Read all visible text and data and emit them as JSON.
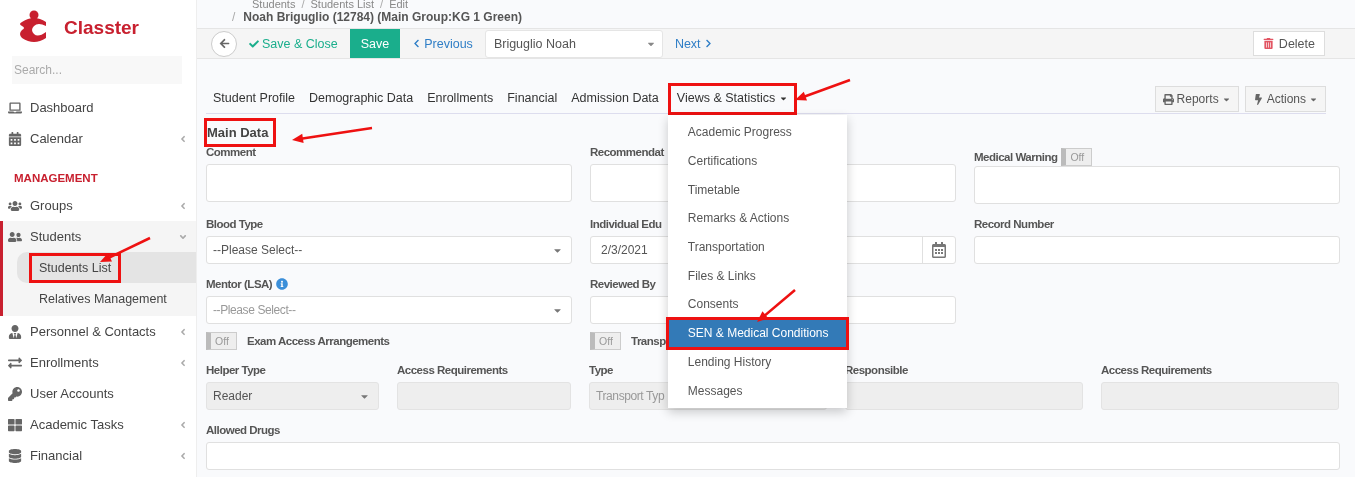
{
  "sidebar": {
    "logo_text": "Classter",
    "search": {
      "placeholder": "Search..."
    },
    "items": [
      {
        "kind": "link",
        "label": "Dashboard"
      },
      {
        "kind": "link",
        "label": "Calendar",
        "expanded": false
      },
      {
        "kind": "section",
        "label": "MANAGEMENT"
      },
      {
        "kind": "link",
        "label": "Groups",
        "expanded": false
      },
      {
        "kind": "link",
        "label": "Students",
        "expanded": true,
        "children": [
          {
            "label": "Students List",
            "selected": true,
            "highlighted": true
          },
          {
            "label": "Relatives Management",
            "selected": false,
            "highlighted": false
          }
        ]
      },
      {
        "kind": "link",
        "label": "Personnel & Contacts",
        "expanded": false
      },
      {
        "kind": "link",
        "label": "Enrollments",
        "expanded": false
      },
      {
        "kind": "link",
        "label": "User Accounts"
      },
      {
        "kind": "link",
        "label": "Academic Tasks",
        "expanded": false
      },
      {
        "kind": "link",
        "label": "Financial",
        "expanded": false
      }
    ]
  },
  "breadcrumb": [
    "Students",
    "Students List",
    "Edit"
  ],
  "breadcrumb_separator": "/",
  "page_title": "Noah Briguglio (12784) (Main Group:KG 1 Green)",
  "toolbar": {
    "save_close": "Save & Close",
    "save": "Save",
    "previous": "Previous",
    "record": "Briguglio Noah",
    "next": "Next",
    "delete": "Delete"
  },
  "tabs": [
    {
      "label": "Student Profile",
      "selected": false,
      "highlighted": false
    },
    {
      "label": "Demographic Data",
      "selected": false,
      "highlighted": false
    },
    {
      "label": "Enrollments",
      "selected": false,
      "highlighted": false
    },
    {
      "label": "Financial",
      "selected": false,
      "highlighted": false
    },
    {
      "label": "Admission Data",
      "selected": false,
      "highlighted": false
    },
    {
      "label": "Views & Statistics",
      "selected": false,
      "highlighted": true,
      "open": true,
      "menu": [
        {
          "label": "Academic Progress",
          "selected": false,
          "highlighted": false
        },
        {
          "label": "Certifications",
          "selected": false,
          "highlighted": false
        },
        {
          "label": "Timetable",
          "selected": false,
          "highlighted": false
        },
        {
          "label": "Remarks & Actions",
          "selected": false,
          "highlighted": false
        },
        {
          "label": "Transportation",
          "selected": false,
          "highlighted": false
        },
        {
          "label": "Files & Links",
          "selected": false,
          "highlighted": false
        },
        {
          "label": "Consents",
          "selected": false,
          "highlighted": false
        },
        {
          "label": "SEN & Medical Conditions",
          "selected": true,
          "highlighted": true
        },
        {
          "label": "Lending History",
          "selected": false,
          "highlighted": false
        },
        {
          "label": "Messages",
          "selected": false,
          "highlighted": false
        }
      ]
    }
  ],
  "tab_tools": [
    "Reports",
    "Actions"
  ],
  "section": {
    "title": "Main Data",
    "highlighted": true
  },
  "rows": [
    {
      "kind": "thirds",
      "fields": [
        {
          "kind": "textarea",
          "label": "Comment"
        },
        {
          "kind": "textarea",
          "label": "Recommendat"
        },
        {
          "kind": "textarea",
          "label": "Medical Warning",
          "switch": {
            "on": false,
            "text": "Off"
          }
        }
      ]
    },
    {
      "kind": "thirds",
      "fields": [
        {
          "kind": "select",
          "label": "Blood Type",
          "value": "--Please Select--"
        },
        {
          "kind": "date",
          "label": "Individual Edu",
          "value": "2/3/2021"
        },
        {
          "kind": "input",
          "label": "Record Number"
        }
      ]
    },
    {
      "kind": "thirds",
      "fields": [
        {
          "kind": "select",
          "label": "Mentor (LSA)",
          "placeholder": "--Please Select--",
          "info": true
        },
        {
          "kind": "input",
          "label": "Reviewed By"
        }
      ]
    },
    {
      "kind": "thirds",
      "fields": [
        {
          "kind": "switch",
          "label": "Exam Access Arrangements",
          "on": false,
          "text": "Off"
        },
        {
          "kind": "switch",
          "label": "Transp",
          "on": false,
          "text": "Off"
        }
      ]
    },
    {
      "kind": "fifths",
      "fields": [
        {
          "kind": "select",
          "label": "Helper Type",
          "value": "Reader",
          "disabled": true
        },
        {
          "kind": "input",
          "label": "Access Requirements",
          "disabled": true
        },
        {
          "kind": "input",
          "label": "Type",
          "placeholder": "Transport Typ",
          "disabled": true
        },
        {
          "kind": "input",
          "label": "Responsible",
          "disabled": true
        },
        {
          "kind": "input",
          "label": "Access Requirements",
          "disabled": true
        }
      ]
    },
    {
      "kind": "full",
      "fields": [
        {
          "kind": "input",
          "label": "Allowed Drugs"
        }
      ]
    }
  ]
}
